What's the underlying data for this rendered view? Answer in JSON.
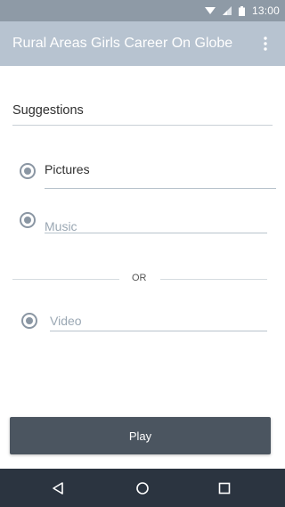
{
  "status_bar": {
    "time": "13:00",
    "icons": [
      "wifi-icon",
      "signal-icon",
      "battery-icon"
    ]
  },
  "app_bar": {
    "title": "Rural Areas Girls Career On Globe",
    "overflow_icon": "more-vert-icon"
  },
  "form": {
    "section_label": "Suggestions",
    "options": [
      {
        "label": "Pictures",
        "selected": true
      },
      {
        "label": "Music",
        "selected": true
      },
      {
        "label": "Video",
        "selected": true
      }
    ],
    "separator_text": "OR"
  },
  "actions": {
    "play_label": "Play"
  },
  "nav_bar": {
    "buttons": [
      "back-icon",
      "home-icon",
      "recents-icon"
    ]
  },
  "colors": {
    "status_bar": "#8e9aa6",
    "app_bar": "#b7c3d0",
    "radio": "#8a96a3",
    "play_button": "#4b5560",
    "nav_bar": "#2b3440"
  }
}
